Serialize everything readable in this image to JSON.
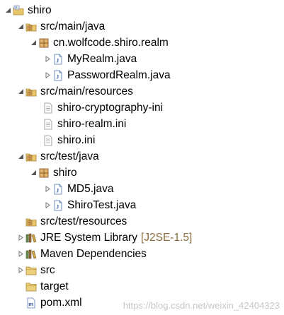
{
  "tree": {
    "project": "shiro",
    "src_main_java": "src/main/java",
    "package_realm": "cn.wolfcode.shiro.realm",
    "file_myrealm": "MyRealm.java",
    "file_passwordrealm": "PasswordRealm.java",
    "src_main_resources": "src/main/resources",
    "file_crypto_ini": "shiro-cryptography-ini",
    "file_realm_ini": "shiro-realm.ini",
    "file_shiro_ini": "shiro.ini",
    "src_test_java": "src/test/java",
    "package_shiro": "shiro",
    "file_md5": "MD5.java",
    "file_shirotest": "ShiroTest.java",
    "src_test_resources": "src/test/resources",
    "jre_library": "JRE System Library",
    "jre_decoration": "[J2SE-1.5]",
    "maven_deps": "Maven Dependencies",
    "folder_src": "src",
    "folder_target": "target",
    "file_pom": "pom.xml"
  },
  "watermark": "https://blog.csdn.net/weixin_42404323",
  "colors": {
    "package_folder": "#c9a24a",
    "java_file": "#3d6fb6",
    "text_file": "#8c8c8c",
    "package": "#8b5a2b",
    "decoration": "#8a6d3b"
  }
}
